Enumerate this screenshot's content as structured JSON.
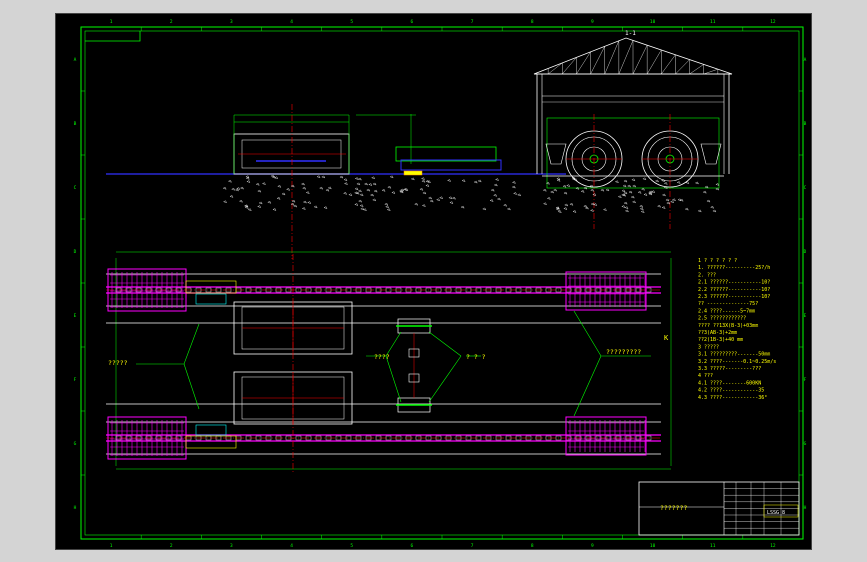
{
  "drawing": {
    "colors": {
      "frame": "#00ff00",
      "conveyor": "#ff00ff",
      "detail": "#ffffff",
      "center_line": "#ff0000",
      "dim": "#00ff00",
      "text": "#ffff00",
      "accent_blue": "#3030ff",
      "cyan": "#00ffff"
    },
    "columns": [
      "1",
      "2",
      "3",
      "4",
      "5",
      "6",
      "7",
      "8",
      "9",
      "10",
      "11",
      "12"
    ],
    "rows": [
      "A",
      "B",
      "C",
      "D",
      "E",
      "F",
      "G",
      "H"
    ],
    "section_label": "1-1",
    "view_label": "K",
    "callouts": {
      "left_upper": "?????",
      "mid_left": "????",
      "mid_right": "? ? ?",
      "right": "?????????"
    },
    "specs": [
      "1 ? ? ? ? ? ?",
      "1.  ??????----------25?/h",
      "2.  ???",
      "2.1  ??????-----------10?",
      "2.2  ??????-----------10?",
      "2.3  ??????-----------10?",
      "         ?? --------------75?",
      "2.4  ????------5~7mm",
      "2.5  ????????????",
      "   ????  ??13X(B-3)+03mm",
      "            ??3(AB-3)+2mm",
      "            ??2(1B-3)+40 mm",
      "3  ?????",
      "3.1  ?????????-------50mm",
      "3.2  ????-------0.1~0.25m/s",
      "3.3  ?????---------???",
      "4  ???",
      "4.1  ????--------600KN",
      "4.2  ????------------35",
      "4.3  ????------------36°"
    ],
    "title_block": {
      "title": "???????",
      "drawing_no": "LSSG 8"
    }
  }
}
